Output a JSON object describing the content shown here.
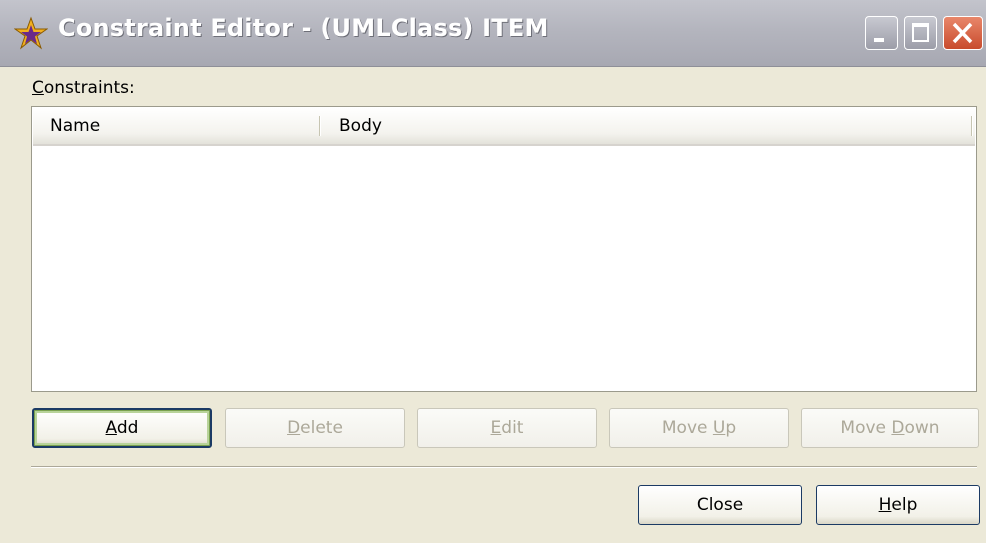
{
  "window": {
    "title": "Constraint Editor - (UMLClass) ITEM",
    "icon": "star-icon",
    "controls": [
      "minimize-icon",
      "maximize-icon",
      "close-icon"
    ]
  },
  "constraints": {
    "label_mnemonic": "C",
    "label_rest": "onstraints:",
    "columns": [
      "Name",
      "Body"
    ],
    "rows": []
  },
  "buttons": {
    "add": {
      "mnemonic": "A",
      "rest": "dd",
      "enabled": true
    },
    "delete": {
      "mnemonic": "D",
      "rest": "elete",
      "enabled": false
    },
    "edit": {
      "mnemonic": "E",
      "rest": "dit",
      "enabled": false
    },
    "move_up": {
      "pre": "Move ",
      "mnemonic": "U",
      "rest": "p",
      "enabled": false
    },
    "move_down": {
      "pre": "Move ",
      "mnemonic": "D",
      "rest": "own",
      "enabled": false
    },
    "close": {
      "label": "Close"
    },
    "help": {
      "mnemonic": "H",
      "rest": "elp"
    }
  },
  "colors": {
    "titlebar": "#b4b5be",
    "dialog_bg": "#ece9d8",
    "close_button": "#c84b2d",
    "disabled_text": "#aca899"
  }
}
